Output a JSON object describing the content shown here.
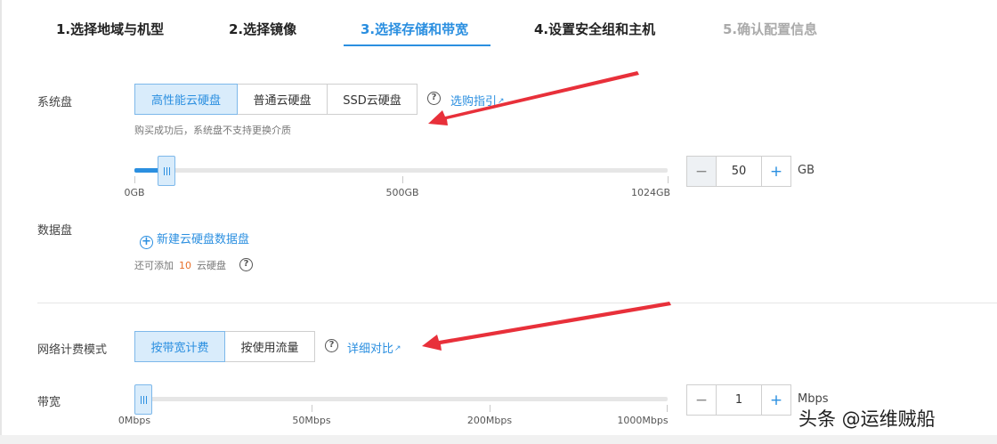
{
  "steps": [
    {
      "label": "1.选择地域与机型",
      "state": "done"
    },
    {
      "label": "2.选择镜像",
      "state": "done"
    },
    {
      "label": "3.选择存储和带宽",
      "state": "active"
    },
    {
      "label": "4.设置安全组和主机",
      "state": "normal"
    },
    {
      "label": "5.确认配置信息",
      "state": "disabled"
    }
  ],
  "system_disk": {
    "label": "系统盘",
    "options": [
      "高性能云硬盘",
      "普通云硬盘",
      "SSD云硬盘"
    ],
    "selected": "高性能云硬盘",
    "help_icon": "question-circle-icon",
    "guide_link": "选购指引",
    "note": "购买成功后，系统盘不支持更换介质",
    "slider_min_label": "0GB",
    "slider_mid_label": "500GB",
    "slider_max_label": "1024GB",
    "slider_min": 0,
    "slider_max": 1024,
    "value": "50",
    "unit": "GB"
  },
  "data_disk": {
    "label": "数据盘",
    "add_link": "新建云硬盘数据盘",
    "remaining_prefix": "还可添加",
    "remaining_count": "10",
    "remaining_suffix": "云硬盘"
  },
  "network": {
    "label": "网络计费模式",
    "options": [
      "按带宽计费",
      "按使用流量"
    ],
    "selected": "按带宽计费",
    "compare_link": "详细对比"
  },
  "bandwidth": {
    "label": "带宽",
    "ticks": [
      "0Mbps",
      "50Mbps",
      "200Mbps",
      "1000Mbps"
    ],
    "value": "1",
    "unit": "Mbps"
  },
  "stepper_symbols": {
    "minus": "−",
    "plus": "+"
  },
  "watermark": "头条 @运维贼船",
  "colors": {
    "accent": "#2b8fe0",
    "selected_bg": "#d9ecfb",
    "arrow": "#e8303a",
    "highlight_number": "#e8702a"
  }
}
